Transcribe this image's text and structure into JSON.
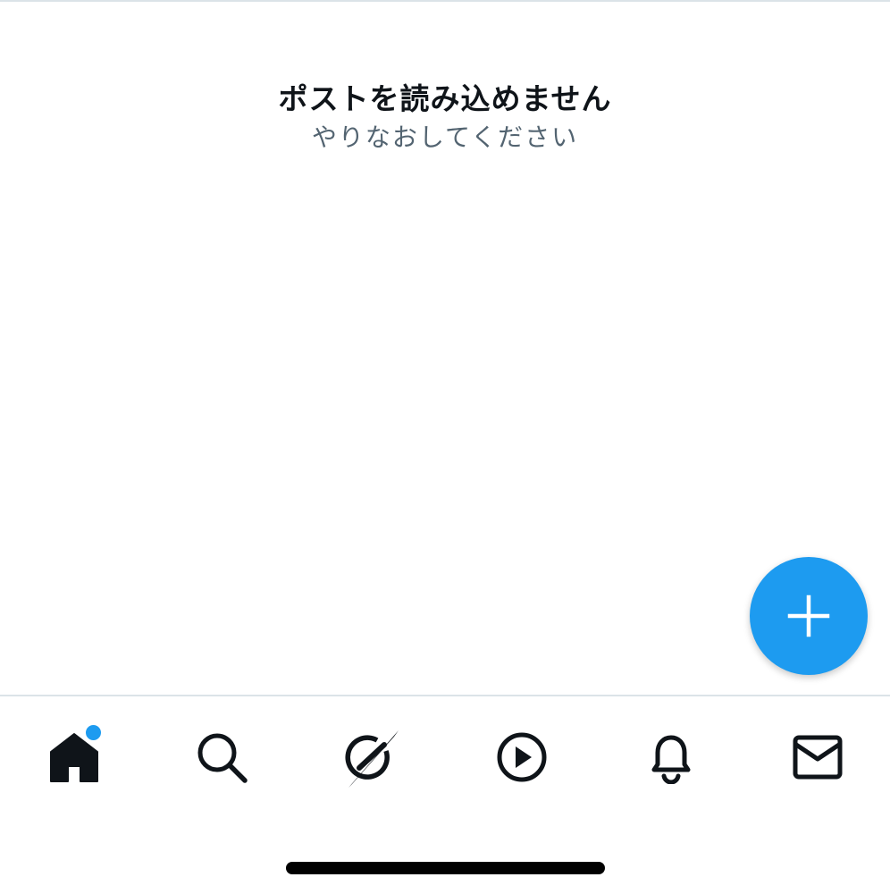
{
  "error": {
    "title": "ポストを読み込めません",
    "subtitle": "やりなおしてください"
  },
  "fab": {
    "icon": "plus-icon",
    "color": "#1d9bf0"
  },
  "tabbar": {
    "items": [
      {
        "id": "home",
        "icon": "home-icon",
        "selected": true,
        "has_badge": true
      },
      {
        "id": "search",
        "icon": "search-icon",
        "selected": false
      },
      {
        "id": "grok",
        "icon": "grok-icon",
        "selected": false
      },
      {
        "id": "video",
        "icon": "play-icon",
        "selected": false
      },
      {
        "id": "notifications",
        "icon": "bell-icon",
        "selected": false
      },
      {
        "id": "messages",
        "icon": "mail-icon",
        "selected": false
      }
    ]
  },
  "colors": {
    "accent": "#1d9bf0",
    "text_primary": "#0f1419",
    "text_secondary": "#536471",
    "divider": "#dbe3e8"
  }
}
